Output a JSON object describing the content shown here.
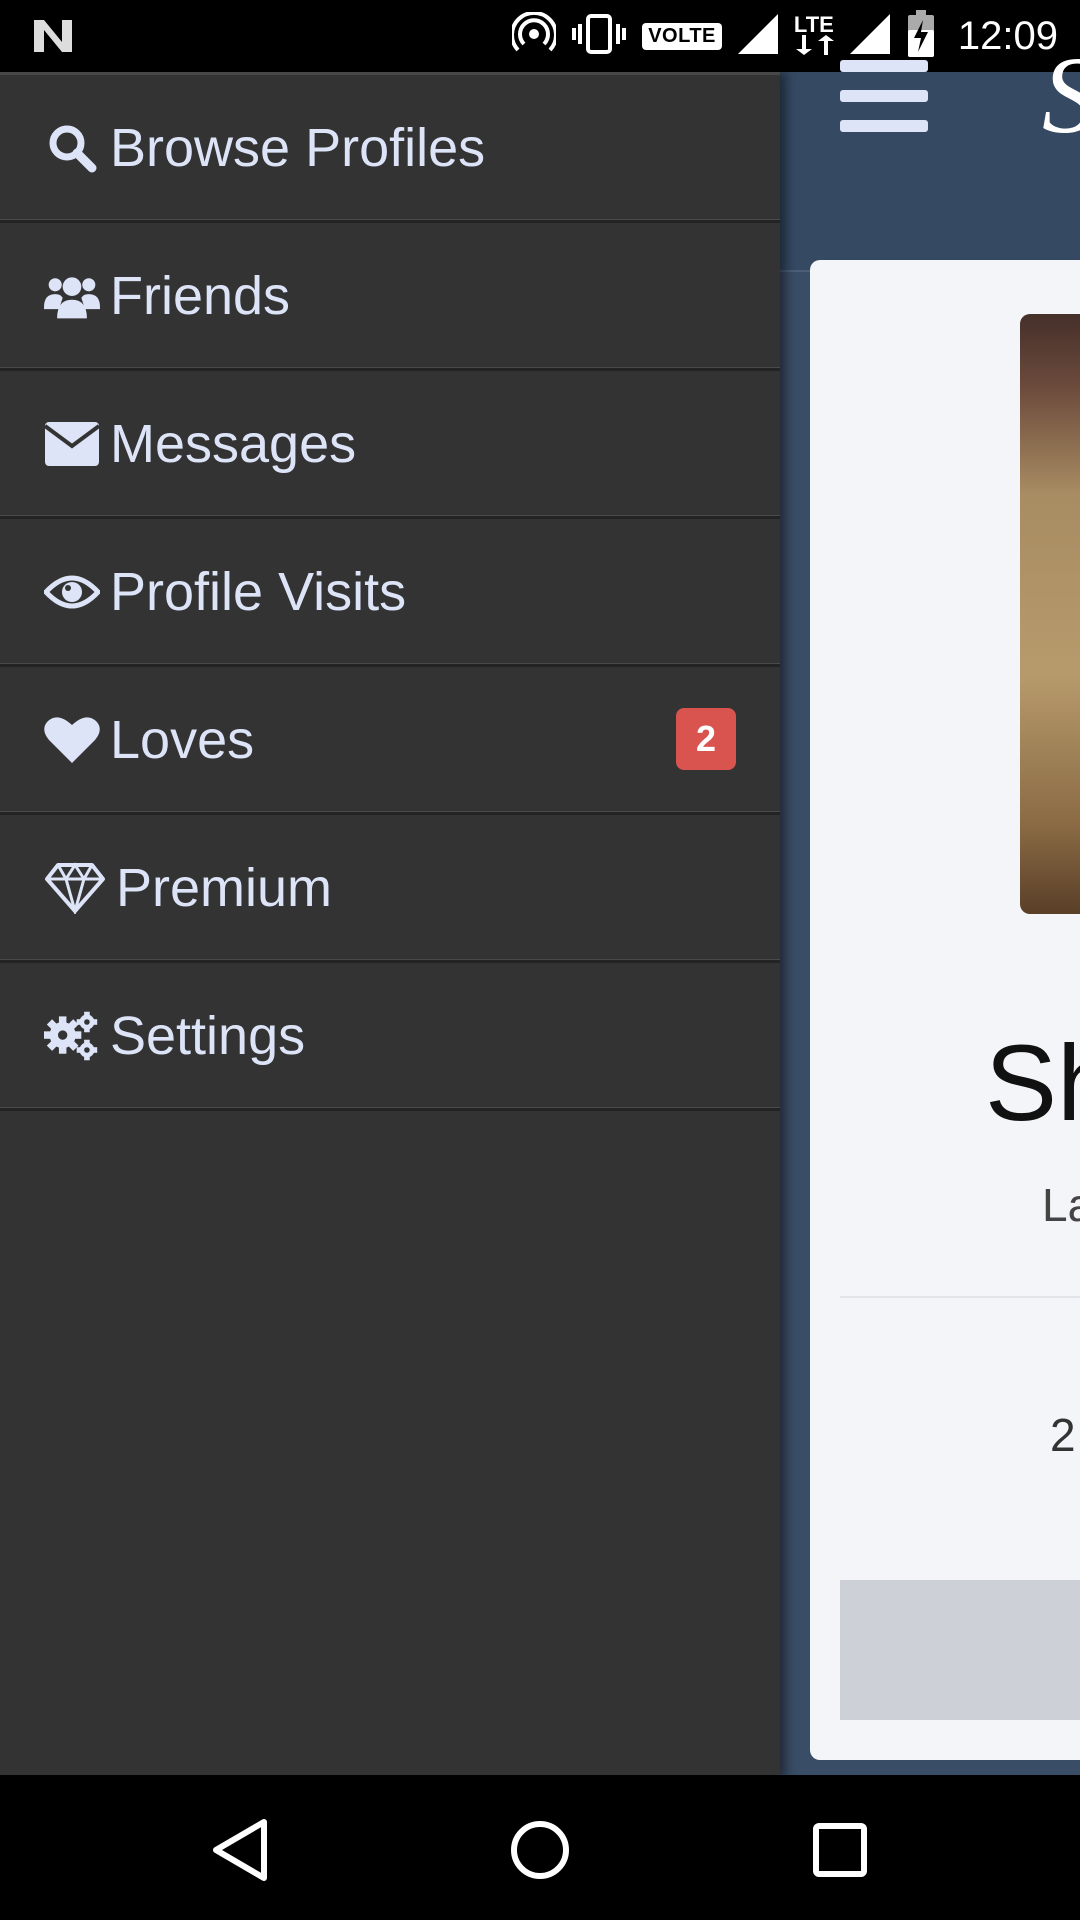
{
  "status_bar": {
    "time": "12:09",
    "volte": "VOLTE",
    "lte": "LTE",
    "icons": [
      "n-icon",
      "hotspot-icon",
      "vibrate-icon",
      "signal-icon",
      "battery-charging-icon"
    ]
  },
  "app": {
    "profile_name_partial": "Sh",
    "profile_sub_partial": "La",
    "profile_num_partial": "2"
  },
  "drawer": {
    "items": [
      {
        "label": "Browse Profiles",
        "icon": "search-icon"
      },
      {
        "label": "Friends",
        "icon": "users-icon"
      },
      {
        "label": "Messages",
        "icon": "envelope-icon"
      },
      {
        "label": "Profile Visits",
        "icon": "eye-icon"
      },
      {
        "label": "Loves",
        "icon": "heart-icon",
        "badge": "2"
      },
      {
        "label": "Premium",
        "icon": "diamond-icon"
      },
      {
        "label": "Settings",
        "icon": "gears-icon"
      }
    ]
  },
  "colors": {
    "drawer_bg": "#333333",
    "menu_text": "#dde4f7",
    "badge": "#d9534f",
    "header": "#354963"
  },
  "navbar": {
    "buttons": [
      "back-icon",
      "home-icon",
      "recents-icon"
    ]
  }
}
